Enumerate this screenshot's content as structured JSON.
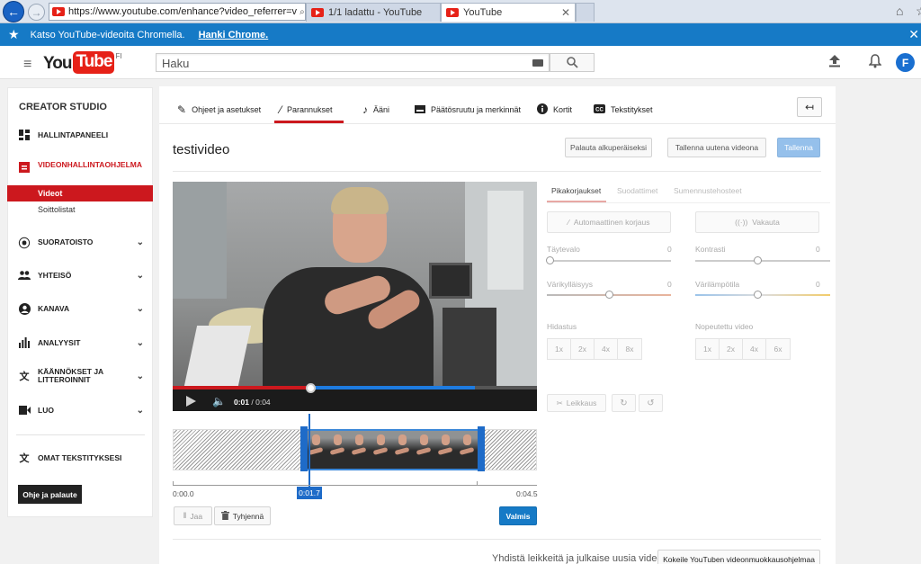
{
  "browser": {
    "url": "https://www.youtube.com/enhance?video_referrer=v",
    "address_tools": "⌕ ▾ 🔒 ↻ ✕",
    "tabs": [
      {
        "title": "1/1 ladattu - YouTube"
      },
      {
        "title": "YouTube"
      }
    ]
  },
  "promo": {
    "text": "Katso YouTube-videoita Chromella.",
    "link": "Hanki Chrome."
  },
  "masthead": {
    "logo_you": "You",
    "logo_tube": "Tube",
    "region": "FI",
    "search_placeholder": "Haku",
    "avatar_letter": "F"
  },
  "sidebar": {
    "title": "CREATOR STUDIO",
    "items": [
      {
        "label": "HALLINTAPANEELI"
      },
      {
        "label": "VIDEONHALLINTAOHJELMA"
      },
      {
        "label": "SUORATOISTO"
      },
      {
        "label": "YHTEISÖ"
      },
      {
        "label": "KANAVA"
      },
      {
        "label": "ANALYYSIT"
      },
      {
        "label": "KÄÄNNÖKSET JA LITTEROINNIT"
      },
      {
        "label": "LUO"
      },
      {
        "label": "OMAT TEKSTITYKSESI"
      }
    ],
    "subitems": [
      "Videot",
      "Soittolistat"
    ],
    "feedback": "Ohje ja palaute"
  },
  "editor": {
    "tabs": [
      {
        "label": "Ohjeet ja asetukset"
      },
      {
        "label": "Parannukset"
      },
      {
        "label": "Ääni"
      },
      {
        "label": "Päätösruutu ja merkinnät"
      },
      {
        "label": "Kortit"
      },
      {
        "label": "Tekstitykset"
      }
    ],
    "video_title": "testivideo",
    "buttons": {
      "restore": "Palauta alkuperäiseksi",
      "save_as_new": "Tallenna uutena videona",
      "save": "Tallenna"
    },
    "player": {
      "current": "0:01",
      "total": "/ 0:04",
      "progress": 0.38
    },
    "timeline": {
      "start": "0:00.0",
      "current": "0:01.7",
      "end": "0:04.5"
    },
    "bottom_buttons": {
      "split": "Jaa",
      "clear": "Tyhjennä",
      "done": "Valmis"
    },
    "footer_text": "Yhdistä leikkeitä ja julkaise uusia videoita.",
    "footer_button": "Kokeile YouTuben videonmuokkausohjelmaa"
  },
  "fixes": {
    "tabs": [
      "Pikakorjaukset",
      "Suodattimet",
      "Sumennustehosteet"
    ],
    "auto_fix": "Automaattinen korjaus",
    "stabilize": "Vakauta",
    "sliders": [
      {
        "label": "Täytevalo",
        "value": "0"
      },
      {
        "label": "Kontrasti",
        "value": "0"
      },
      {
        "label": "Värikylläisyys",
        "value": "0"
      },
      {
        "label": "Värilämpötila",
        "value": "0"
      }
    ],
    "slow_label": "Hidastus",
    "slow_options": [
      "1x",
      "2x",
      "4x",
      "8x"
    ],
    "fast_label": "Nopeutettu video",
    "fast_options": [
      "1x",
      "2x",
      "4x",
      "6x"
    ],
    "trim": "Leikkaus"
  },
  "colors": {
    "brand_red": "#cc181e",
    "accent_blue": "#167ac6"
  }
}
